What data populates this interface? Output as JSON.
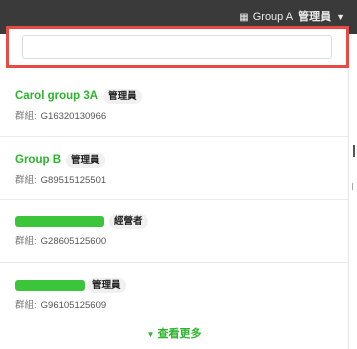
{
  "topbar": {
    "group_label": "Group A",
    "role_label": "管理員",
    "chevron": "▼",
    "icon": "building-icon"
  },
  "search": {
    "value": "",
    "placeholder": ""
  },
  "items": [
    {
      "name": "Carol group 3A",
      "role": "管理員",
      "id_prefix": "群組:",
      "id": "G16320130966"
    },
    {
      "name": "Group B",
      "role": "管理員",
      "id_prefix": "群組:",
      "id": "G89515125501"
    },
    {
      "name": "",
      "role": "經營者",
      "id_prefix": "群組:",
      "id": "G28605125600"
    },
    {
      "name": "",
      "role": "管理員",
      "id_prefix": "群組:",
      "id": "G96105125609"
    }
  ],
  "more": {
    "label": "查看更多",
    "arrow": "▼"
  },
  "colors": {
    "accent_green": "#2bb52b",
    "highlight_red": "#e84a44",
    "topbar": "#3a3a3a"
  }
}
